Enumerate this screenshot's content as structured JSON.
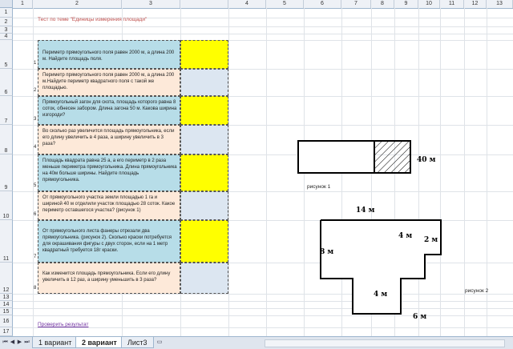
{
  "columns": [
    "1",
    "2",
    "3",
    "4",
    "5",
    "6",
    "7",
    "8",
    "9",
    "10",
    "11",
    "12",
    "13"
  ],
  "rows": [
    "1",
    "2",
    "3",
    "4",
    "5",
    "6",
    "7",
    "8",
    "9",
    "10",
    "11",
    "12",
    "13",
    "14",
    "15",
    "16",
    "17"
  ],
  "title": "Тест по теме \"Единицы измерения площади\"",
  "questions": [
    {
      "num": "1",
      "text": "Периметр прямоугольного поля равен 2000 м, а длина 200 м. Найдите площадь поля."
    },
    {
      "num": "2",
      "text": "Периметр прямоугольного поля равен 2000 м, а длина 200 м.Найдите периметр квадратного поля с такой же площадью."
    },
    {
      "num": "3",
      "text": "Прямоугольный загон для скота, площадь которого равна 8 соток, обнесен забором. Длина загона 50 м. Какова ширина изгороди?"
    },
    {
      "num": "4",
      "text": "Во сколько раз увеличится площадь прямоугольника, если его длину увеличить в 4 раза, а ширину увеличить в 3 раза?"
    },
    {
      "num": "5",
      "text": "Площадь квадрата равна 25 а, а его периметр в 2 раза меньше периметра прямоугольника. Длина прямоугольника на 40м больше ширины. Найдите площадь прямоугольника."
    },
    {
      "num": "6",
      "text": "От прямоугольного  участка земли площадью 1 га и шириной 40 м отделили участок площадью 28 соток. Какое периметр оставшегося участка? (рисунок 1)"
    },
    {
      "num": "7",
      "text": "От прямоугольного листа фанеры отрезали два прямоугольника. (рисунок 2). Сколько краски потребуется  для окрашивания фигуры с двух сторон, если на 1 метр квадратный требуется 18г краски."
    },
    {
      "num": "8",
      "text": "Как изменится площадь прямоугольника. Если его длину увеличить в 12 раз, а ширину уменьшить в 3 раза?"
    }
  ],
  "check_link": "Проверить результат",
  "figure1": {
    "caption": "рисунок 1",
    "label": "40 м"
  },
  "figure2": {
    "caption": "рисунок 2",
    "top": "14 м",
    "left": "8 м",
    "notch_h": "4 м",
    "notch_w": "2 м",
    "bottom_h": "4 м",
    "bottom_w": "6 м"
  },
  "tabs": [
    "1 вариант",
    "2 вариант",
    "Лист3"
  ],
  "active_tab": "2 вариант",
  "colors": {
    "blue": "#b7dde8",
    "peach": "#fde9d9",
    "yellow": "#ffff00",
    "light_blue": "#dce6f1",
    "title": "#c0504d",
    "link": "#7030a0"
  }
}
